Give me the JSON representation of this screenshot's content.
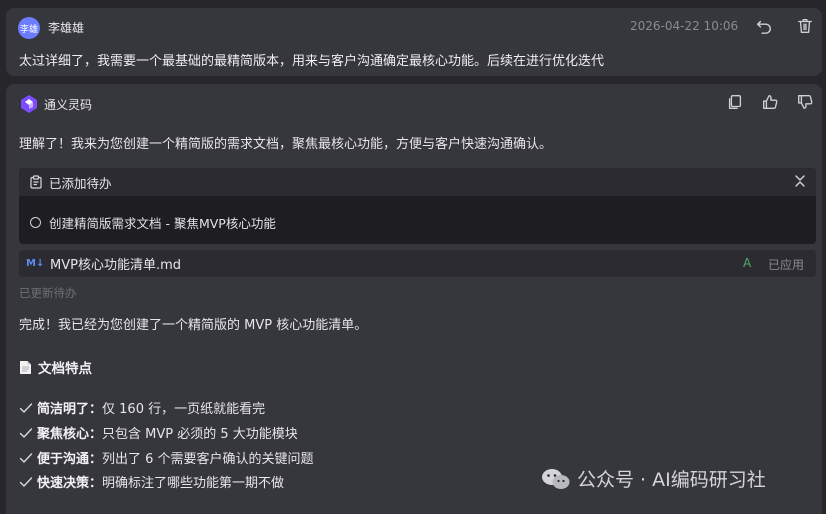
{
  "user_message": {
    "avatar_text": "李雄",
    "name": "李雄雄",
    "timestamp": "2026-04-22 10:06",
    "text": "太过详细了，我需要一个最基础的最精简版本，用来与客户沟通确定最核心功能。后续在进行优化迭代"
  },
  "ai_message": {
    "name": "通义灵码",
    "intro": "理解了！我来为您创建一个精简版的需求文档，聚焦最核心功能，方便与客户快速沟通确认。",
    "todo": {
      "header": "已添加待办",
      "items": [
        {
          "label": "创建精简版需求文档 - 聚焦MVP核心功能"
        }
      ]
    },
    "file": {
      "badge": "M↓",
      "name": "MVP核心功能清单.md",
      "change_marker": "A",
      "status": "已应用"
    },
    "updated_note": "已更新待办",
    "done_text": "完成！我已经为您创建了一个精简版的 MVP 核心功能清单。",
    "features_title": "文档特点",
    "features": [
      {
        "title": "简洁明了：",
        "desc": "仅 160 行，一页纸就能看完"
      },
      {
        "title": "聚焦核心：",
        "desc": "只包含 MVP 必须的 5 大功能模块"
      },
      {
        "title": "便于沟通：",
        "desc": "列出了 6 个需要客户确认的关键问题"
      },
      {
        "title": "快速决策：",
        "desc": "明确标注了哪些功能第一期不做"
      }
    ]
  },
  "watermark": {
    "text": "公众号 · AI编码研习社"
  },
  "colors": {
    "background": "#26262b",
    "card": "#36363d",
    "todo_bg": "#1e1e22",
    "accent_blue": "#5a8dee",
    "added_green": "#4caf6a",
    "muted": "#8a8a94"
  }
}
